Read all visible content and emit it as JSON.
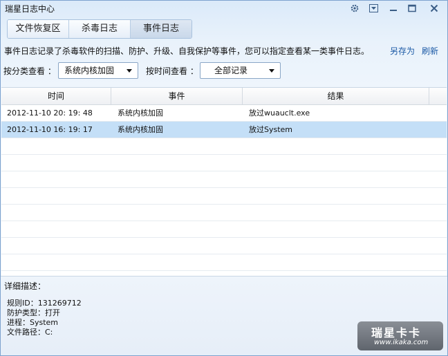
{
  "window": {
    "title": "瑞星日志中心"
  },
  "titlebar": {
    "icons": [
      "gear-icon",
      "skin-icon",
      "minimize-icon",
      "maximize-icon",
      "close-icon"
    ]
  },
  "tabs": [
    {
      "label": "文件恢复区",
      "active": false
    },
    {
      "label": "杀毒日志",
      "active": false
    },
    {
      "label": "事件日志",
      "active": true
    }
  ],
  "description": "事件日志记录了杀毒软件的扫描、防护、升级、自我保护等事件，您可以指定查看某一类事件日志。",
  "actions": {
    "save_as": "另存为",
    "refresh": "刷新"
  },
  "filters": {
    "category_label": "按分类查看 ：",
    "category_value": "系统内核加固",
    "time_label": "按时间查看 ：",
    "time_value": "全部记录"
  },
  "table": {
    "columns": [
      "时间",
      "事件",
      "结果"
    ],
    "rows": [
      {
        "time": "2012-11-10 20: 19: 48",
        "event": "系统内核加固",
        "result": "放过wuauclt.exe",
        "selected": false
      },
      {
        "time": "2012-11-10 16: 19: 17",
        "event": "系统内核加固",
        "result": "放过System",
        "selected": true
      }
    ]
  },
  "detail": {
    "title": "详细描述：",
    "lines": [
      "规则ID：131269712",
      "防护类型：打开",
      "进程：System",
      "文件路径：C:"
    ]
  },
  "watermark": {
    "brand": "瑞星卡卡",
    "url": "www.ikaka.com"
  }
}
